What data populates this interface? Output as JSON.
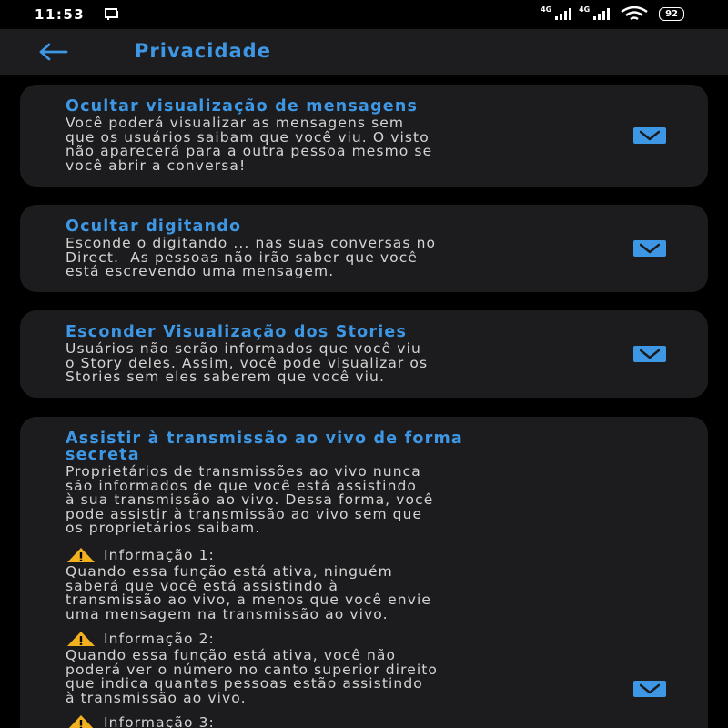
{
  "status": {
    "time": "11:53",
    "network1": "4G",
    "network2": "4G",
    "battery": "92"
  },
  "header": {
    "title": "Privacidade"
  },
  "cards": [
    {
      "title": "Ocultar visualização de mensagens",
      "description": "Você poderá visualizar as mensagens sem\nque os usuários saibam que você viu. O visto\nnão aparecerá para a outra pessoa mesmo se\nvocê abrir a conversa!",
      "checked": true
    },
    {
      "title": "Ocultar digitando",
      "description": "Esconde o digitando ... nas suas conversas no\nDirect.  As pessoas não irão saber que você\nestá escrevendo uma mensagem.",
      "checked": true
    },
    {
      "title": "Esconder Visualização dos Stories",
      "description": "Usuários não serão informados que você viu\no Story deles. Assim, você pode visualizar os\nStories sem eles saberem que você viu.",
      "checked": true
    },
    {
      "title_line1": "Assistir à transmissão ao vivo de forma",
      "title_line2": "secreta",
      "description": "Proprietários de transmissões ao vivo nunca\nsão informados de que você está assistindo\nà sua transmissão ao vivo. Dessa forma, você\npode assistir à transmissão ao vivo sem que\nos proprietários saibam.",
      "info": [
        {
          "label": "Informação 1:",
          "text": "Quando essa função está ativa, ninguém\nsaberá que você está assistindo à\ntransmissão ao vivo, a menos que você envie\numa mensagem na transmissão ao vivo."
        },
        {
          "label": "Informação 2:",
          "text": "Quando essa função está ativa, você não\npoderá ver o número no canto superior direito\nque indica quantas pessoas estão assistindo\nà transmissão ao vivo."
        },
        {
          "label": "Informação 3:",
          "text": ""
        }
      ],
      "checked": true
    }
  ],
  "colors": {
    "accent": "#3d97e4",
    "card": "#1c1c1e",
    "appbar": "#1d1d1f",
    "text": "#d4d4d4"
  },
  "icons": {
    "back": "arrow-left-icon",
    "check": "checkmark-icon",
    "warning": "warning-triangle-icon"
  }
}
